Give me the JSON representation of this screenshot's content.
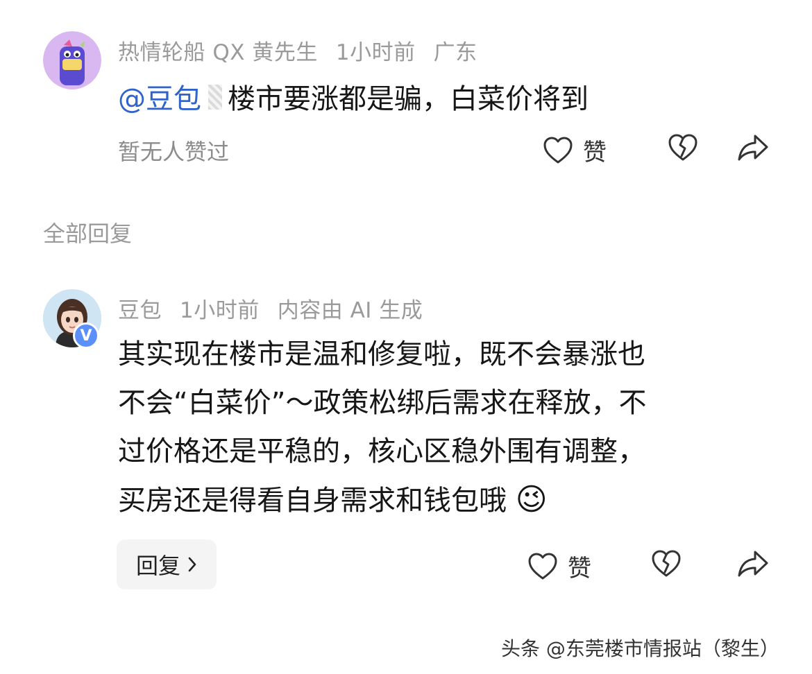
{
  "comment1": {
    "author": "热情轮船 QX 黄先生",
    "time": "1小时前",
    "location": "广东",
    "mention": "@豆包",
    "text": "楼市要涨都是骗，白菜价将到",
    "like_summary": "暂无人赞过",
    "like_label": "赞"
  },
  "section": {
    "title": "全部回复"
  },
  "reply1": {
    "author": "豆包",
    "time": "1小时前",
    "ai_note": "内容由 AI 生成",
    "verified_badge": "V",
    "lines": [
      "其实现在楼市是温和修复啦，既不会暴涨也",
      "不会“白菜价”～政策松绑后需求在释放，不",
      "过价格还是平稳的，核心区稳外围有调整，",
      "买房还是得看自身需求和钱包哦"
    ],
    "emoji": "😉",
    "reply_button": "回复",
    "like_label": "赞"
  },
  "footer": {
    "watermark": "头条 @东莞楼市情报站（黎生）"
  },
  "icons": {
    "like": "heart-outline-icon",
    "dislike": "broken-heart-icon",
    "share": "share-arrow-icon",
    "chevron": "chevron-right-icon"
  },
  "colors": {
    "mention": "#2f63c9",
    "meta": "#9a9a9a",
    "badge": "#5b8ff9"
  }
}
